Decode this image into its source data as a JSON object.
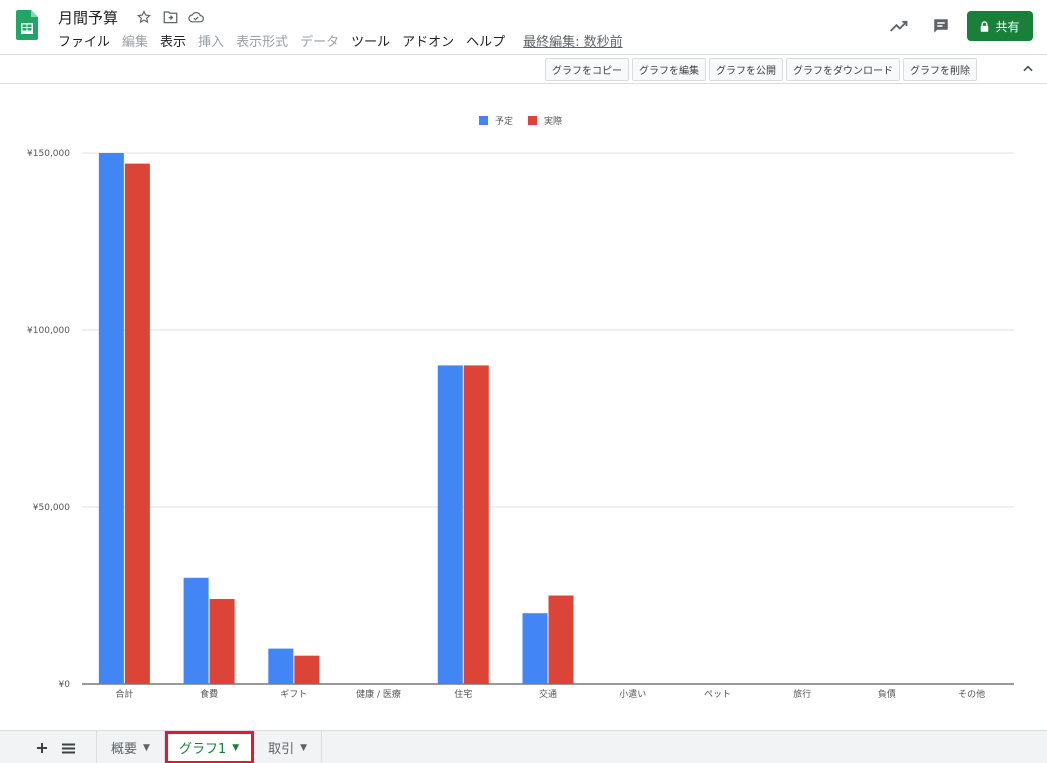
{
  "app": {
    "title": "月間予算",
    "menu": [
      {
        "label": "ファイル",
        "enabled": true
      },
      {
        "label": "編集",
        "enabled": false
      },
      {
        "label": "表示",
        "enabled": true
      },
      {
        "label": "挿入",
        "enabled": false
      },
      {
        "label": "表示形式",
        "enabled": false
      },
      {
        "label": "データ",
        "enabled": false
      },
      {
        "label": "ツール",
        "enabled": true
      },
      {
        "label": "アドオン",
        "enabled": true
      },
      {
        "label": "ヘルプ",
        "enabled": true
      }
    ],
    "last_edit": "最終編集: 数秒前",
    "share_label": "共有",
    "colors": {
      "accent": "#188038",
      "highlight": "#e8162f"
    }
  },
  "chart_toolbar": {
    "buttons": [
      "グラフをコピー",
      "グラフを編集",
      "グラフを公開",
      "グラフをダウンロード",
      "グラフを削除"
    ]
  },
  "chart_data": {
    "type": "bar",
    "categories": [
      "合計",
      "食費",
      "ギフト",
      "健康 / 医療",
      "住宅",
      "交通",
      "小遣い",
      "ペット",
      "旅行",
      "負債",
      "その他"
    ],
    "series": [
      {
        "name": "予定",
        "color": "#4285f4",
        "values": [
          150000,
          30000,
          10000,
          0,
          90000,
          20000,
          0,
          0,
          0,
          0,
          0
        ]
      },
      {
        "name": "実際",
        "color": "#db4437",
        "values": [
          147000,
          24000,
          8000,
          0,
          90000,
          25000,
          0,
          0,
          0,
          0,
          0
        ]
      }
    ],
    "ylim": [
      0,
      150000
    ],
    "yticks": [
      0,
      50000,
      100000,
      150000
    ],
    "ytick_labels": [
      "¥0",
      "¥50,000",
      "¥100,000",
      "¥150,000"
    ],
    "grid": true,
    "legend": "top-center"
  },
  "sheets": {
    "tabs": [
      {
        "label": "概要",
        "active": false
      },
      {
        "label": "グラフ1",
        "active": true
      },
      {
        "label": "取引",
        "active": false
      }
    ]
  }
}
